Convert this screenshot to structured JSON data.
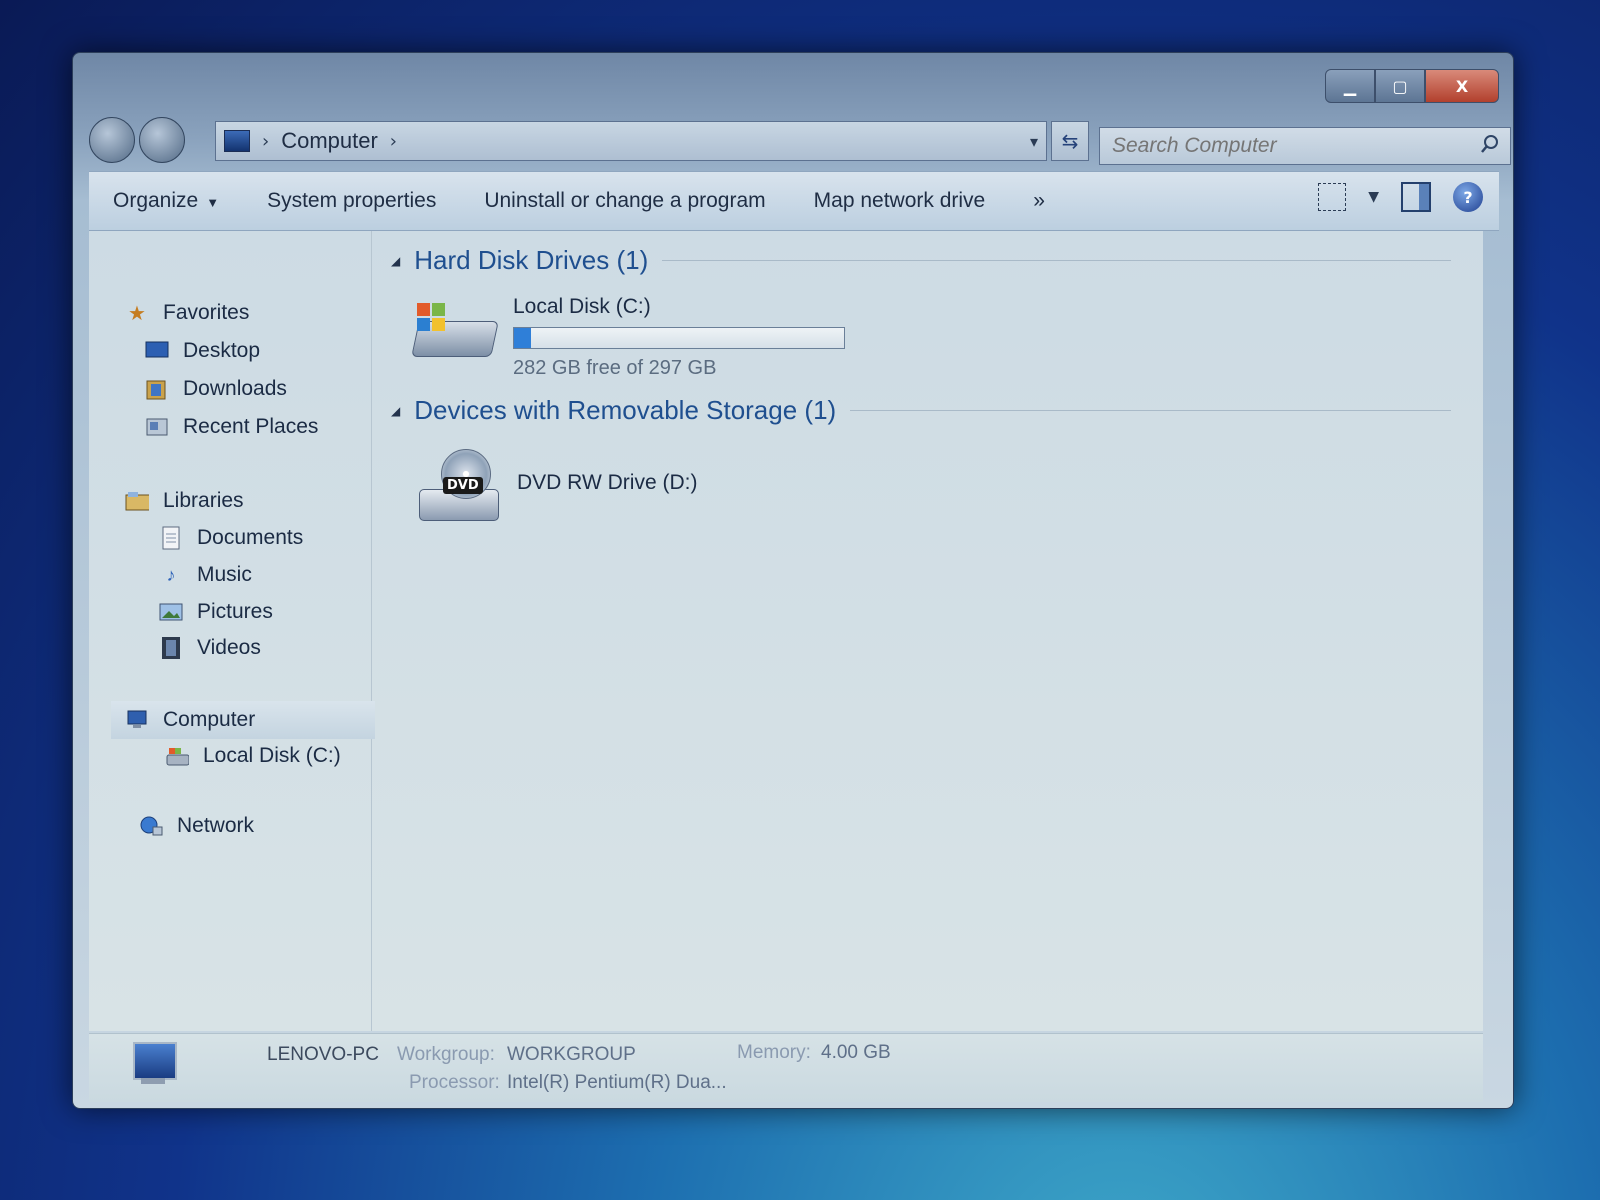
{
  "window": {
    "caption": {
      "minimize": "▁",
      "maximize": "▢",
      "close": "X"
    }
  },
  "address": {
    "path_label": "Computer",
    "separator_1": "›",
    "separator_2": "›",
    "dropdown": "▾",
    "refresh": "⇆"
  },
  "search": {
    "placeholder": "Search Computer"
  },
  "toolbar": {
    "organize": "Organize",
    "system_properties": "System properties",
    "uninstall": "Uninstall or change a program",
    "map_network": "Map network drive",
    "more": "»",
    "help": "?"
  },
  "nav": {
    "favorites": "Favorites",
    "desktop": "Desktop",
    "downloads": "Downloads",
    "recent_places": "Recent Places",
    "libraries": "Libraries",
    "documents": "Documents",
    "music": "Music",
    "pictures": "Pictures",
    "videos": "Videos",
    "computer": "Computer",
    "local_disk": "Local Disk (C:)",
    "network": "Network"
  },
  "groups": {
    "hdd_title": "Hard Disk Drives (1)",
    "removable_title": "Devices with Removable Storage (1)"
  },
  "drives": {
    "local_disk": {
      "name": "Local Disk (C:)",
      "free_text": "282 GB free of 297 GB",
      "used_fraction": 0.05
    },
    "dvd": {
      "name": "DVD RW Drive (D:)",
      "badge": "DVD"
    }
  },
  "details": {
    "pc_name": "LENOVO-PC",
    "workgroup_label": "Workgroup:",
    "workgroup_value": "WORKGROUP",
    "memory_label": "Memory:",
    "memory_value": "4.00 GB",
    "processor_label": "Processor:",
    "processor_value": "Intel(R) Pentium(R) Dua..."
  },
  "colors": {
    "accent": "#1f4f8f",
    "usage_fill": "#2f7fd8"
  }
}
